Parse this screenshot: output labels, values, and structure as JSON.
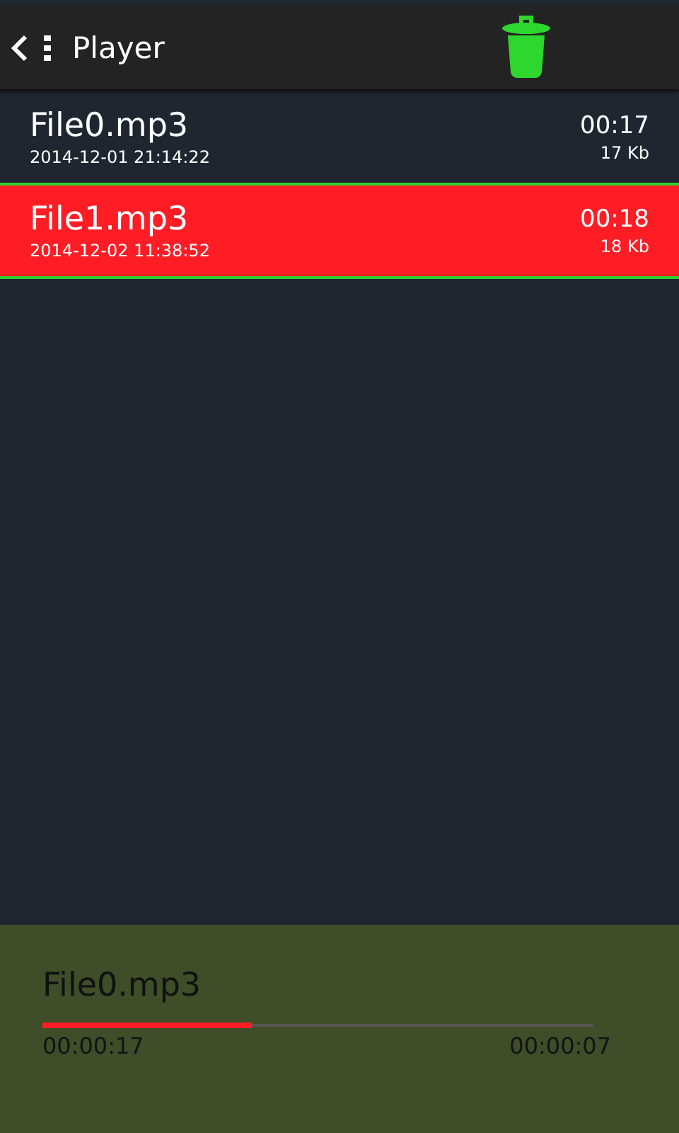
{
  "toolbar": {
    "title": "Player"
  },
  "files": [
    {
      "name": "File0.mp3",
      "date": "2014-12-01 21:14:22",
      "duration": "00:17",
      "size": "17 Kb",
      "selected": false
    },
    {
      "name": "File1.mp3",
      "date": "2014-12-02 11:38:52",
      "duration": "00:18",
      "size": "18 Kb",
      "selected": true
    }
  ],
  "player": {
    "track": "File0.mp3",
    "level": 0.38,
    "elapsed": "00:00:17",
    "remaining": "00:00:07"
  }
}
